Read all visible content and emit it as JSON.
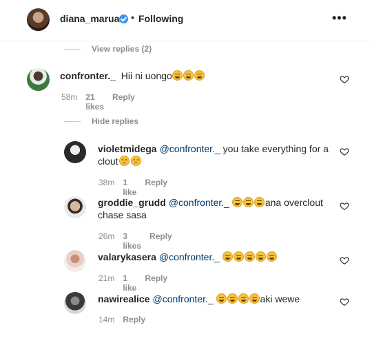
{
  "header": {
    "username": "diana_marua",
    "dot": "•",
    "follow_status": "Following",
    "more": "•••"
  },
  "view_replies": "View replies (2)",
  "hide_replies": "Hide replies",
  "comments": [
    {
      "username": "confronter._",
      "text": "Hii ni uongo",
      "emojis": 3,
      "time": "58m",
      "likes": "21 likes",
      "reply": "Reply"
    }
  ],
  "replies": [
    {
      "username": "violetmidega",
      "mention": "@confronter._",
      "text_line1": " you take everything for a",
      "text_line2": "clout",
      "time": "38m",
      "likes": "1 like",
      "reply": "Reply"
    },
    {
      "username": "groddie_grudd",
      "mention": "@confronter._",
      "text_line1": "ana overclout",
      "text_line2": "chase sasa",
      "time": "26m",
      "likes": "3 likes",
      "reply": "Reply"
    },
    {
      "username": "valarykasera",
      "mention": "@confronter._",
      "time": "21m",
      "likes": "1 like",
      "reply": "Reply"
    },
    {
      "username": "nawirealice",
      "mention": "@confronter._",
      "text_line1": "aki wewe",
      "time": "14m",
      "reply": "Reply"
    }
  ]
}
